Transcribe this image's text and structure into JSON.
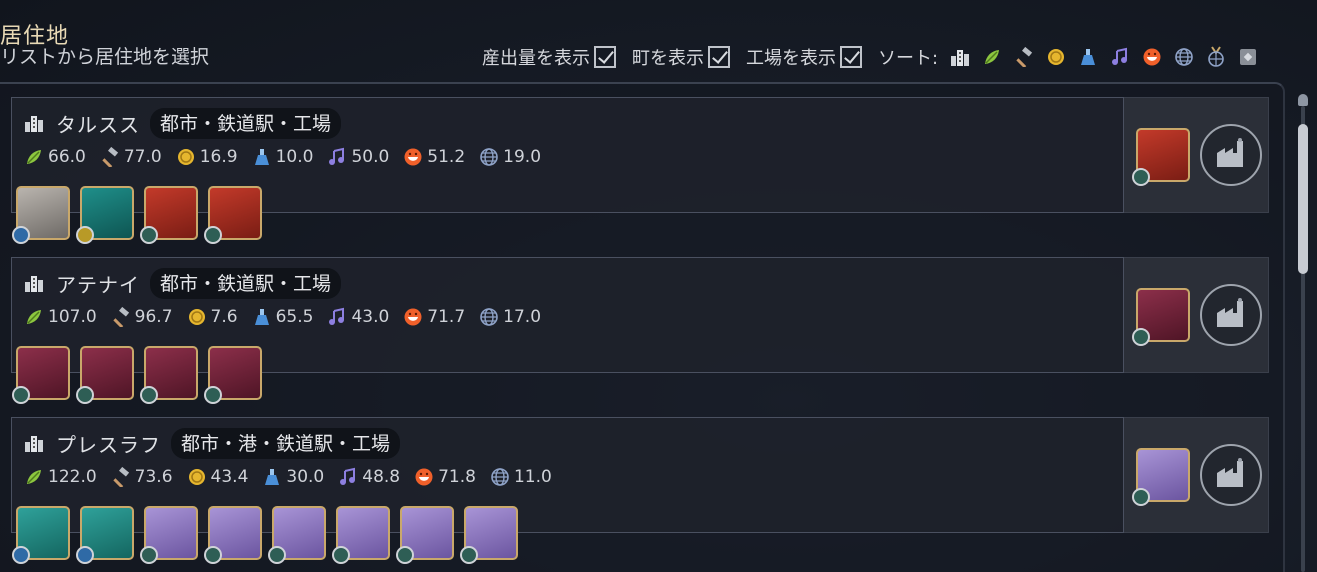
{
  "header": {
    "title": "居住地",
    "subtitle": "リストから居住地を選択"
  },
  "toolbar": {
    "show_output_label": "産出量を表示",
    "show_towns_label": "町を表示",
    "show_factories_label": "工場を表示",
    "sort_label": "ソート:",
    "sort_icons": [
      "city-icon",
      "food-icon",
      "production-icon",
      "gold-icon",
      "science-icon",
      "culture-icon",
      "happiness-icon",
      "influence-icon",
      "medal-icon",
      "other-icon"
    ]
  },
  "colors": {
    "accent": "#e8d9b5",
    "food": "#8cc63f",
    "gold": "#e6b62e",
    "science": "#4a8fd8",
    "culture": "#8d7fe0",
    "happiness": "#f0602a",
    "influence": "#8fa3c8"
  },
  "cities": [
    {
      "name": "タルスス",
      "tags": "都市・鉄道駅・工場",
      "yields": [
        "66.0",
        "77.0",
        "16.9",
        "10.0",
        "50.0",
        "51.2",
        "19.0"
      ],
      "resources": [
        {
          "kind": "pearl",
          "badge": "blue",
          "name": "pearls-icon"
        },
        {
          "kind": "ivory",
          "badge": "gold",
          "name": "ivory-icon"
        },
        {
          "kind": "choco",
          "badge": "green",
          "name": "cocoa-icon"
        },
        {
          "kind": "choco",
          "badge": "green",
          "name": "cocoa-icon"
        }
      ],
      "factory_resource": {
        "kind": "choco",
        "badge": "green",
        "name": "cocoa-icon"
      }
    },
    {
      "name": "アテナイ",
      "tags": "都市・鉄道駅・工場",
      "yields": [
        "107.0",
        "96.7",
        "7.6",
        "65.5",
        "43.0",
        "71.7",
        "17.0"
      ],
      "resources": [
        {
          "kind": "coffee",
          "badge": "green",
          "name": "tea-icon"
        },
        {
          "kind": "coffee",
          "badge": "green",
          "name": "tea-icon"
        },
        {
          "kind": "coffee",
          "badge": "green",
          "name": "tea-icon"
        },
        {
          "kind": "coffee",
          "badge": "green",
          "name": "tea-icon"
        }
      ],
      "factory_resource": {
        "kind": "coffee",
        "badge": "green",
        "name": "tea-icon"
      }
    },
    {
      "name": "プレスラフ",
      "tags": "都市・港・鉄道駅・工場",
      "yields": [
        "122.0",
        "73.6",
        "43.4",
        "30.0",
        "48.8",
        "71.8",
        "11.0"
      ],
      "resources": [
        {
          "kind": "fur",
          "badge": "blue",
          "name": "furs-icon"
        },
        {
          "kind": "fur",
          "badge": "blue",
          "name": "furs-icon"
        },
        {
          "kind": "cotton",
          "badge": "green",
          "name": "cotton-icon"
        },
        {
          "kind": "cotton",
          "badge": "green",
          "name": "cotton-icon"
        },
        {
          "kind": "cotton",
          "badge": "green",
          "name": "cotton-icon"
        },
        {
          "kind": "cotton",
          "badge": "green",
          "name": "cotton-icon"
        },
        {
          "kind": "cotton",
          "badge": "green",
          "name": "cotton-icon"
        },
        {
          "kind": "cotton",
          "badge": "green",
          "name": "cotton-icon"
        }
      ],
      "factory_resource": {
        "kind": "cotton",
        "badge": "green",
        "name": "cotton-icon"
      }
    }
  ]
}
